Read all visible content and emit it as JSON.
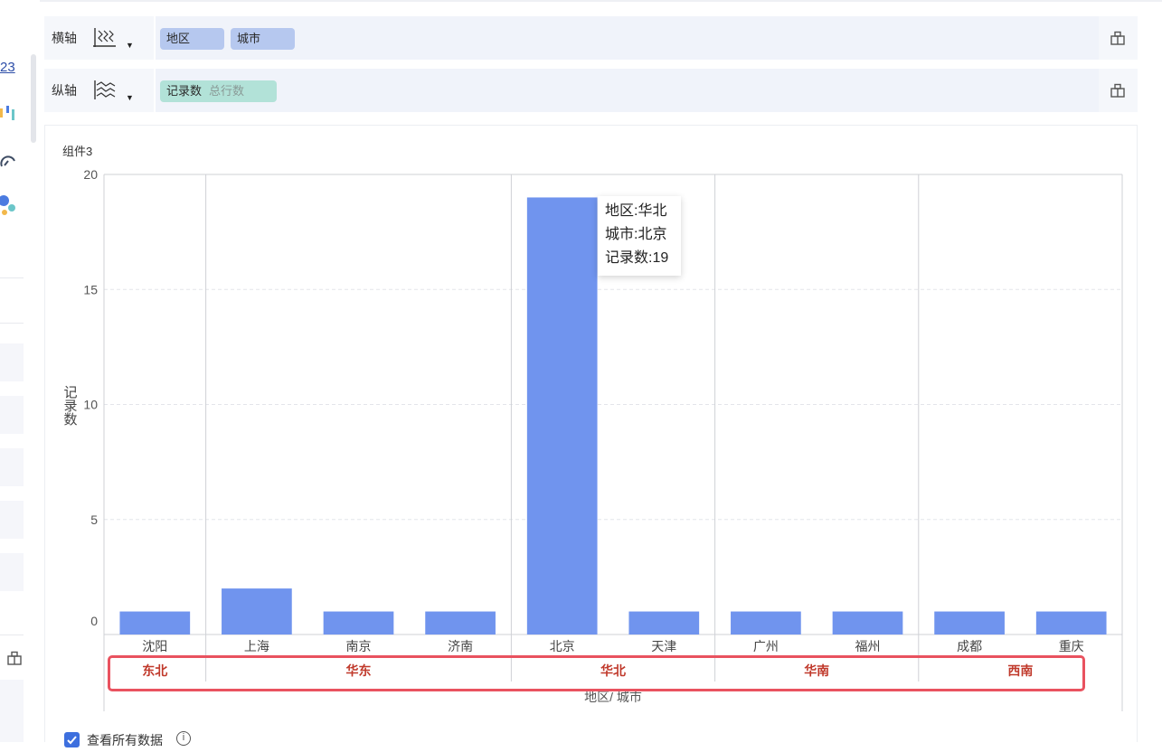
{
  "left_panel": {
    "partial_label": "23"
  },
  "x_axis_row": {
    "label": "横轴",
    "icon": "axis-ruler-icon",
    "fields": [
      "地区",
      "城市"
    ]
  },
  "y_axis_row": {
    "label": "纵轴",
    "icon": "axis-wave-icon",
    "field": "记录数",
    "field_sub": "总行数"
  },
  "chart": {
    "title": "组件3"
  },
  "chart_data": {
    "type": "bar",
    "categories": [
      "沈阳",
      "上海",
      "南京",
      "济南",
      "北京",
      "天津",
      "广州",
      "福州",
      "成都",
      "重庆"
    ],
    "values": [
      1,
      2,
      1,
      1,
      19,
      1,
      1,
      1,
      1,
      1
    ],
    "groups": [
      {
        "name": "东北",
        "count": 1
      },
      {
        "name": "华东",
        "count": 3
      },
      {
        "name": "华北",
        "count": 2
      },
      {
        "name": "华南",
        "count": 2
      },
      {
        "name": "西南",
        "count": 2
      }
    ],
    "xlabel": "地区/ 城市",
    "ylabel": "记录数",
    "ylim": [
      0,
      20
    ],
    "yticks": [
      0,
      5,
      10,
      15,
      20
    ],
    "bar_color": "#7094ee",
    "group_label_color": "#c0392b"
  },
  "tooltip": {
    "lines": [
      "地区:华北",
      "城市:北京",
      "记录数:19"
    ]
  },
  "footer": {
    "checkbox_label": "查看所有数据"
  }
}
